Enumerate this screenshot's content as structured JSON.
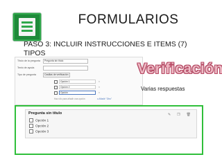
{
  "header": {
    "title": "FORMULARIOS",
    "step_line1": "PASO 3: INCLUIR INSTRUCCIONES E ITEMS (7)",
    "step_line2": "TIPOS"
  },
  "editor": {
    "labels": [
      "Título de la pregunta",
      "Texto de ayuda",
      "Tipo de pregunta"
    ],
    "question_title": "Pregunta sin título",
    "question_type": "Casillas de verificación",
    "options": [
      "Opción 1",
      "Opción 2",
      "Opción"
    ],
    "add_option": "Haz clic para añadir una opción",
    "other_link": "o Añadir \"Otro\""
  },
  "verification_title": "Verificación",
  "verification_caption": "Varias respuestas",
  "preview": {
    "question": "Pregunta sin título",
    "options": [
      "Opción 1",
      "Opción 2",
      "Opción 3"
    ],
    "icons": [
      "edit-icon",
      "copy-icon",
      "delete-icon"
    ]
  },
  "colors": {
    "logo_green": "#1f8a3a",
    "frame_green": "#2fbf3a",
    "verification_fill": "#f0b8c4",
    "verification_outline": "#b94864"
  }
}
